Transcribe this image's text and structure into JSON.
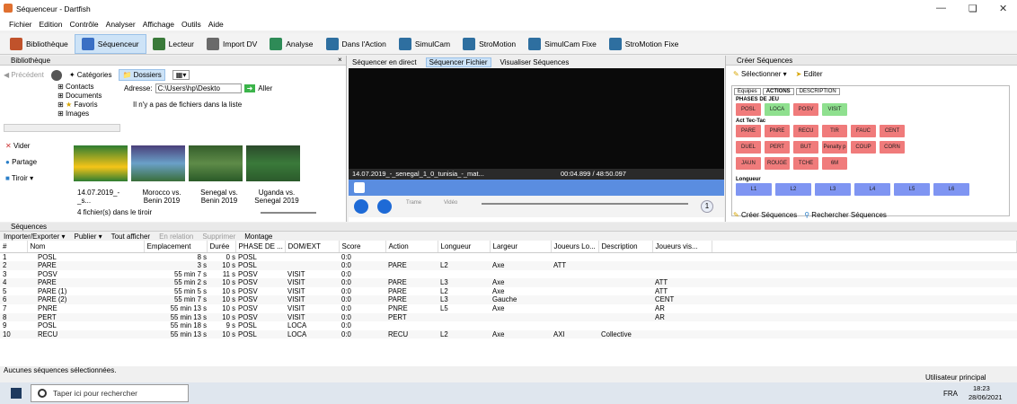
{
  "window": {
    "title": "Séquenceur - Dartfish"
  },
  "menu": [
    "Fichier",
    "Edition",
    "Contrôle",
    "Analyser",
    "Affichage",
    "Outils",
    "Aide"
  ],
  "toolbar": [
    {
      "label": "Bibliothèque",
      "icon": "library-icon",
      "color": "#c0522b"
    },
    {
      "label": "Séquenceur",
      "icon": "sequencer-icon",
      "color": "#3a6fc4",
      "active": true
    },
    {
      "label": "Lecteur",
      "icon": "player-icon",
      "color": "#3a7a3a"
    },
    {
      "label": "Import DV",
      "icon": "import-dv-icon",
      "color": "#6a6a6a"
    },
    {
      "label": "Analyse",
      "icon": "analysis-icon",
      "color": "#2e8b57"
    },
    {
      "label": "Dans l'Action",
      "icon": "in-action-icon",
      "color": "#2e6fa0"
    },
    {
      "label": "SimulCam",
      "icon": "simulcam-icon",
      "color": "#2e6fa0"
    },
    {
      "label": "StroMotion",
      "icon": "stromotion-icon",
      "color": "#2e6fa0"
    },
    {
      "label": "SimulCam Fixe",
      "icon": "simulcam-fixe-icon",
      "color": "#2e6fa0"
    },
    {
      "label": "StroMotion Fixe",
      "icon": "stromotion-fixe-icon",
      "color": "#2e6fa0"
    }
  ],
  "library": {
    "title": "Bibliothèque",
    "back": "Précédent",
    "categories": "Catégories",
    "folders": "Dossiers",
    "tree": [
      "Contacts",
      "Documents",
      "Favoris",
      "Images"
    ],
    "address_label": "Adresse:",
    "address_value": "C:\\Users\\hp\\Deskto",
    "go": "Aller",
    "empty_msg": "Il n'y a pas de fichiers dans la liste",
    "actions": [
      "Vider",
      "Partage",
      "Tiroir"
    ],
    "thumbs": [
      "14.07.2019_-_s...",
      "Morocco vs. Benin 2019",
      "Senegal vs. Benin 2019",
      "Uganda vs. Senegal 2019"
    ],
    "drawer_count": "4 fichier(s) dans le tiroir"
  },
  "video": {
    "tabs": [
      "Séquencer en direct",
      "Séquencer Fichier",
      "Visualiser Séquences"
    ],
    "filename": "14.07.2019_-_senegal_1_0_tunisia_-_mat...",
    "timecode": "00:04.899 / 48:50.097",
    "frame_label": "Trame",
    "video_label": "Vidéo",
    "speeds": [
      "-16",
      "-8",
      "-4",
      "-2",
      "-1",
      "0.0",
      "0.2",
      "0.5",
      "1",
      "2",
      "4",
      "8",
      "16"
    ],
    "speed_value": "1"
  },
  "seq_panel": {
    "title": "Créer Séquences",
    "select": "Sélectionner",
    "edit": "Editer",
    "tabs": [
      "Equipes",
      "ACTIONS",
      "DESCRIPTION"
    ],
    "section1": "PHASES DE JEU",
    "phases": [
      "POSL",
      "LOCA",
      "POSV",
      "VISIT"
    ],
    "section2": "Act Tec-Tac",
    "actions_row1": [
      "PARE",
      "PNRE",
      "RECU",
      "TIR",
      "FAUC",
      "CENT"
    ],
    "actions_row2": [
      "DUEL",
      "PERT",
      "BUT",
      "Penalty p",
      "COUP",
      "CORN"
    ],
    "actions_row3": [
      "JAUN",
      "ROUGE",
      "TCHE",
      "6M"
    ],
    "section3": "Longueur",
    "lengths": [
      "L1",
      "L2",
      "L3",
      "L4",
      "L5",
      "L6"
    ],
    "bottom_tabs": [
      "Créer Séquences",
      "Rechercher Séquences"
    ]
  },
  "sequences": {
    "title": "Séquences",
    "toolbar": [
      "Importer/Exporter",
      "Publier",
      "Tout afficher",
      "En relation",
      "Supprimer",
      "Montage"
    ],
    "columns": [
      "#",
      "Nom",
      "Emplacement",
      "Durée",
      "PHASE DE ...",
      "DOM/EXT",
      "Score",
      "Action",
      "Longueur",
      "Largeur",
      "Joueurs Lo...",
      "Description",
      "Joueurs vis..."
    ],
    "rows": [
      [
        "1",
        "POSL",
        "8 s",
        "0 s",
        "POSL",
        "",
        "0:0",
        "",
        "",
        "",
        "",
        "",
        ""
      ],
      [
        "2",
        "PARE",
        "3 s",
        "10 s",
        "POSL",
        "",
        "0:0",
        "PARE",
        "L2",
        "Axe",
        "ATT",
        "",
        ""
      ],
      [
        "3",
        "POSV",
        "55 min 7 s",
        "11 s",
        "POSV",
        "VISIT",
        "0:0",
        "",
        "",
        "",
        "",
        "",
        ""
      ],
      [
        "4",
        "PARE",
        "55 min 2 s",
        "10 s",
        "POSV",
        "VISIT",
        "0:0",
        "PARE",
        "L3",
        "Axe",
        "",
        "",
        "ATT"
      ],
      [
        "5",
        "PARE (1)",
        "55 min 5 s",
        "10 s",
        "POSV",
        "VISIT",
        "0:0",
        "PARE",
        "L2",
        "Axe",
        "",
        "",
        "ATT"
      ],
      [
        "6",
        "PARE (2)",
        "55 min 7 s",
        "10 s",
        "POSV",
        "VISIT",
        "0:0",
        "PARE",
        "L3",
        "Gauche",
        "",
        "",
        "CENT"
      ],
      [
        "7",
        "PNRE",
        "55 min 13 s",
        "10 s",
        "POSV",
        "VISIT",
        "0:0",
        "PNRE",
        "L5",
        "Axe",
        "",
        "",
        "AR"
      ],
      [
        "8",
        "PERT",
        "55 min 13 s",
        "10 s",
        "POSV",
        "VISIT",
        "0:0",
        "PERT",
        "",
        "",
        "",
        "",
        "AR"
      ],
      [
        "9",
        "POSL",
        "55 min 18 s",
        "9 s",
        "POSL",
        "LOCA",
        "0:0",
        "",
        "",
        "",
        "",
        "",
        ""
      ],
      [
        "10",
        "RECU",
        "55 min 13 s",
        "10 s",
        "POSL",
        "LOCA",
        "0:0",
        "RECU",
        "L2",
        "Axe",
        "AXI",
        "Collective",
        ""
      ]
    ],
    "status": "Aucunes séquences sélectionnées."
  },
  "statusbar": {
    "user": "Utilisateur principal"
  },
  "taskbar": {
    "search": "Taper ici pour rechercher",
    "lang": "FRA",
    "time": "18:23",
    "date": "28/06/2021"
  },
  "colors": {
    "pad_red": "#f07b7b",
    "pad_green": "#8fe08f",
    "pad_blue": "#7f95f2",
    "accent": "#1e6ad6"
  }
}
